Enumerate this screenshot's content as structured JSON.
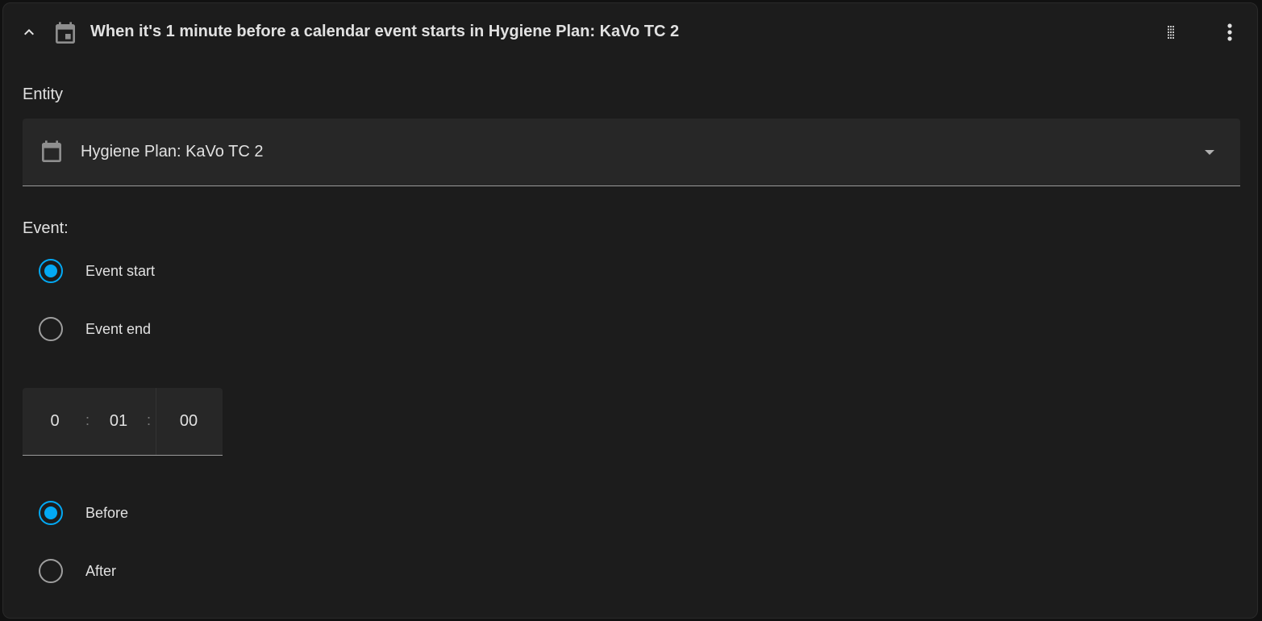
{
  "header": {
    "collapse_icon": "chevron-up-icon",
    "calendar_icon": "calendar-icon",
    "title": "When it's 1 minute before a calendar event starts in Hygiene Plan: KaVo TC 2",
    "drag_icon": "drag-handle-icon",
    "menu_icon": "more-vertical-icon"
  },
  "entity": {
    "label": "Entity",
    "value": "Hygiene Plan: KaVo TC 2",
    "icon": "calendar-icon"
  },
  "event": {
    "label": "Event:",
    "options": [
      {
        "label": "Event start",
        "checked": true
      },
      {
        "label": "Event end",
        "checked": false
      }
    ]
  },
  "offset": {
    "hours": "0",
    "minutes": "01",
    "seconds": "00",
    "separator": ":"
  },
  "direction": {
    "options": [
      {
        "label": "Before",
        "checked": true
      },
      {
        "label": "After",
        "checked": false
      }
    ]
  },
  "colors": {
    "accent": "#03a9f4",
    "card_background": "#1c1c1c",
    "field_background": "#272727",
    "text": "#e1e1e1"
  }
}
